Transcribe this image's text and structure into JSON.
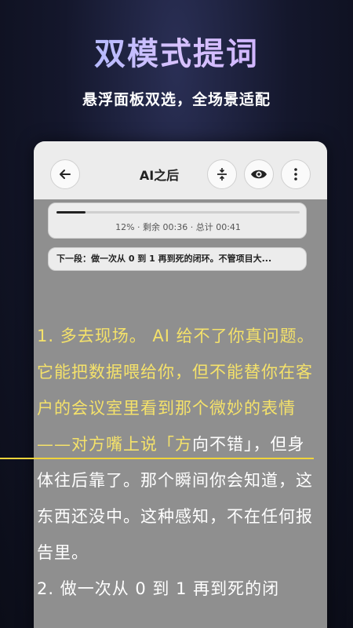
{
  "hero": {
    "title": "双模式提词",
    "subtitle": "悬浮面板双选，全场景适配"
  },
  "topbar": {
    "title": "AI之后",
    "icons": [
      "back-arrow-icon",
      "fold-icon",
      "eye-icon",
      "more-vertical-icon"
    ]
  },
  "progress": {
    "percent": 12,
    "text": "12% · 剩余 00:36 · 总计 00:41"
  },
  "next_segment": {
    "text": "下一段：做一次从 0 到 1 再到死的闭环。不管项目大..."
  },
  "script": {
    "active_text": "1. 多去现场。 AI 给不了你真问题。它能把数据喂给你，但不能替你在客户的会议室里看到那个微妙的表情——对方嘴上说「方",
    "rest_text": "向不错」，但身体往后靠了。那个瞬间你会知道，这东西还没中。这种感知，不在任何报告里。",
    "next_text": "2. 做一次从 0 到 1 再到死的闭"
  },
  "colors": {
    "highlight": "#f5e26a",
    "panel_bg": "#8f8f8f",
    "bar_bg": "#ececec"
  }
}
